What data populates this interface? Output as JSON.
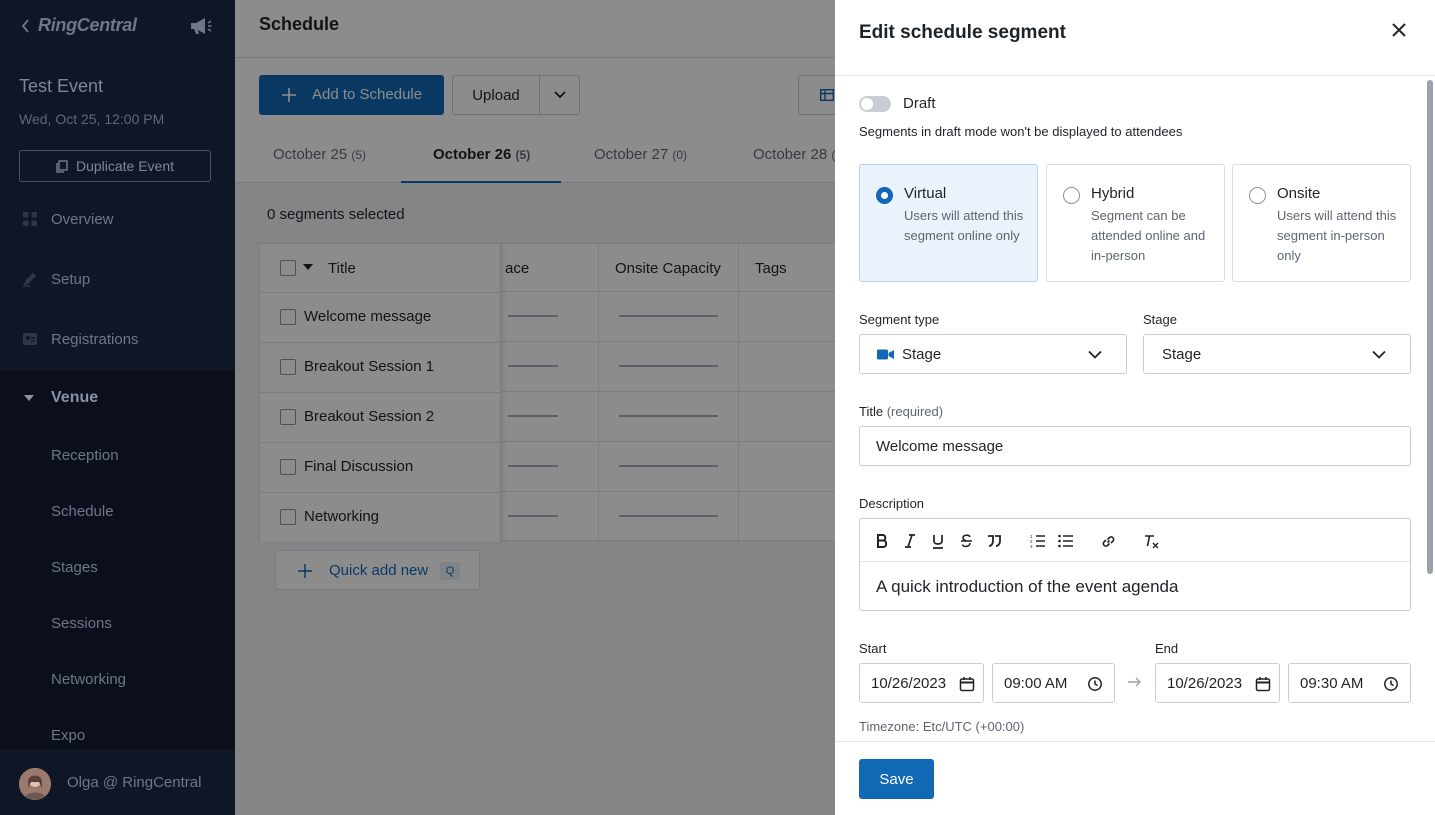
{
  "sidebar": {
    "brand": "RingCentral",
    "event_title": "Test Event",
    "event_date": "Wed, Oct 25, 12:00 PM",
    "duplicate_label": "Duplicate Event",
    "nav": [
      {
        "label": "Overview",
        "icon": "grid-icon"
      },
      {
        "label": "Setup",
        "icon": "pencil-icon"
      },
      {
        "label": "Registrations",
        "icon": "id-card-icon"
      }
    ],
    "venue_label": "Venue",
    "venue_items": [
      "Reception",
      "Schedule",
      "Stages",
      "Sessions",
      "Networking",
      "Expo"
    ],
    "user_name": "Olga @ RingCentral"
  },
  "main": {
    "page_title": "Schedule",
    "add_label": "Add to Schedule",
    "upload_label": "Upload",
    "tabs": [
      {
        "label": "October 25",
        "count": "(5)"
      },
      {
        "label": "October 26",
        "count": "(5)"
      },
      {
        "label": "October 27",
        "count": "(0)"
      },
      {
        "label": "October 28",
        "count": "("
      }
    ],
    "selected_count": "0 segments selected",
    "table": {
      "col_title": "Title",
      "col_space": "ace",
      "col_onsite": "Onsite Capacity",
      "col_tags": "Tags",
      "rows": [
        "Welcome message",
        "Breakout Session 1",
        "Breakout Session 2",
        "Final Discussion",
        "Networking"
      ]
    },
    "quick_add_label": "Quick add new",
    "quick_add_key": "Q"
  },
  "drawer": {
    "title": "Edit schedule segment",
    "draft_label": "Draft",
    "draft_help": "Segments in draft mode won't be displayed to attendees",
    "modes": [
      {
        "title": "Virtual",
        "desc": "Users will attend this segment online only",
        "selected": true
      },
      {
        "title": "Hybrid",
        "desc": "Segment can be attended online and in-person",
        "selected": false
      },
      {
        "title": "Onsite",
        "desc": "Users will attend this segment in-person only",
        "selected": false
      }
    ],
    "segment_type_label": "Segment type",
    "segment_type_value": "Stage",
    "stage_label": "Stage",
    "stage_value": "Stage",
    "title_label": "Title",
    "title_required": "(required)",
    "title_value": "Welcome message",
    "description_label": "Description",
    "description_value": "A quick introduction of the event agenda",
    "start_label": "Start",
    "end_label": "End",
    "start_date": "10/26/2023",
    "start_time": "09:00 AM",
    "end_date": "10/26/2023",
    "end_time": "09:30 AM",
    "timezone": "Timezone: Etc/UTC (+00:00)",
    "save_label": "Save"
  },
  "colors": {
    "primary": "#1168b5",
    "sidebar_bg": "#0f1626",
    "selected_card": "#eaf2fb"
  }
}
